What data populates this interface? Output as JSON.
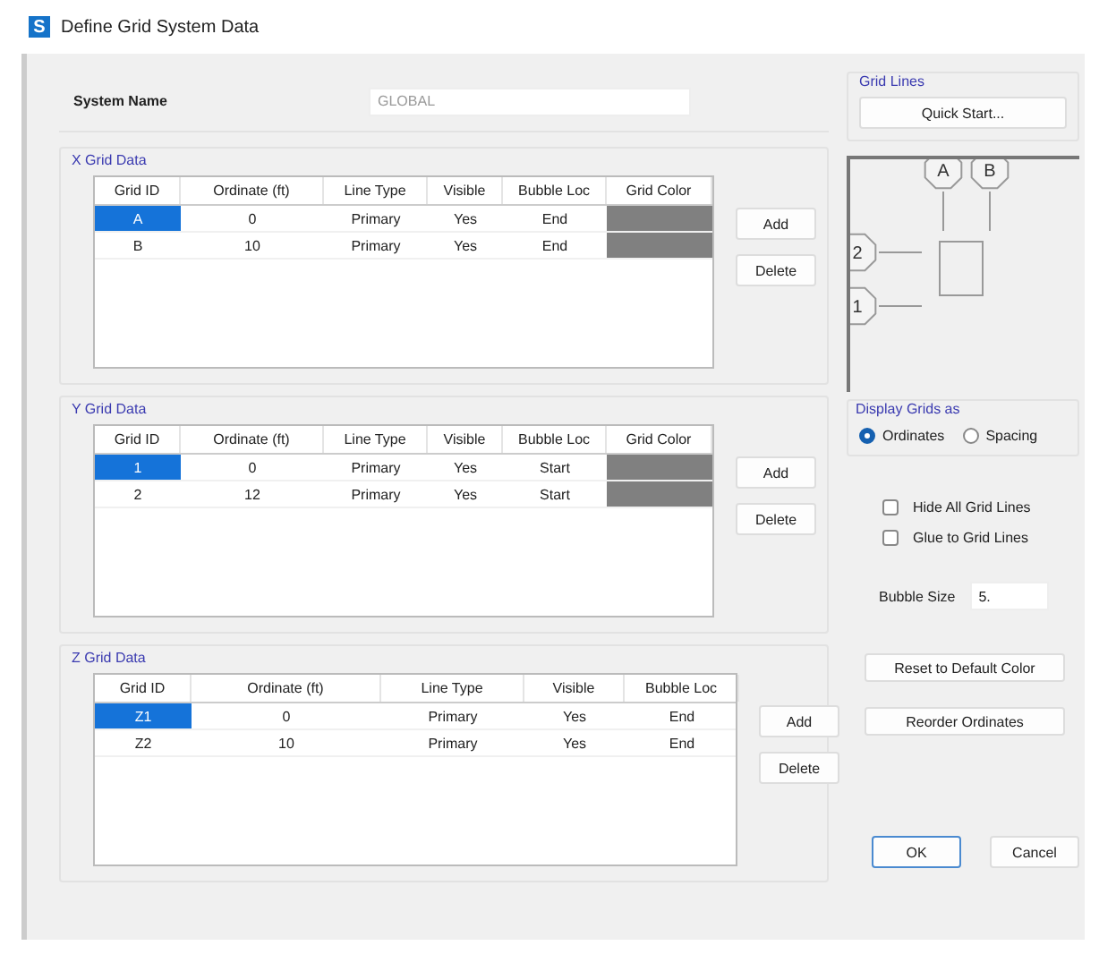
{
  "window": {
    "icon": "S",
    "title": "Define Grid System Data"
  },
  "system_name": {
    "label": "System Name",
    "value": "GLOBAL"
  },
  "grids": [
    {
      "title": "X Grid Data",
      "columns": [
        "Grid ID",
        "Ordinate (ft)",
        "Line Type",
        "Visible",
        "Bubble Loc",
        "Grid Color"
      ],
      "rows": [
        {
          "selected": true,
          "cells": [
            "A",
            "0",
            "Primary",
            "Yes",
            "End"
          ],
          "color": "#808080"
        },
        {
          "selected": false,
          "cells": [
            "B",
            "10",
            "Primary",
            "Yes",
            "End"
          ],
          "color": "#808080"
        }
      ],
      "buttons": [
        "Add",
        "Delete"
      ]
    },
    {
      "title": "Y Grid Data",
      "columns": [
        "Grid ID",
        "Ordinate (ft)",
        "Line Type",
        "Visible",
        "Bubble Loc",
        "Grid Color"
      ],
      "rows": [
        {
          "selected": true,
          "cells": [
            "1",
            "0",
            "Primary",
            "Yes",
            "Start"
          ],
          "color": "#808080"
        },
        {
          "selected": false,
          "cells": [
            "2",
            "12",
            "Primary",
            "Yes",
            "Start"
          ],
          "color": "#808080"
        }
      ],
      "buttons": [
        "Add",
        "Delete"
      ]
    },
    {
      "title": "Z Grid Data",
      "columns": [
        "Grid ID",
        "Ordinate (ft)",
        "Line Type",
        "Visible",
        "Bubble Loc"
      ],
      "rows": [
        {
          "selected": true,
          "cells": [
            "Z1",
            "0",
            "Primary",
            "Yes",
            "End"
          ]
        },
        {
          "selected": false,
          "cells": [
            "Z2",
            "10",
            "Primary",
            "Yes",
            "End"
          ]
        }
      ],
      "buttons": [
        "Add",
        "Delete"
      ]
    }
  ],
  "grid_lines": {
    "title": "Grid Lines",
    "button": "Quick Start..."
  },
  "preview": {
    "x_bubbles": [
      "A",
      "B"
    ],
    "y_bubbles": [
      "2",
      "1"
    ]
  },
  "display_grids": {
    "title": "Display Grids as",
    "options": [
      {
        "label": "Ordinates",
        "selected": true
      },
      {
        "label": "Spacing",
        "selected": false
      }
    ]
  },
  "checkboxes": [
    {
      "label": "Hide All Grid Lines",
      "checked": false
    },
    {
      "label": "Glue to Grid Lines",
      "checked": false
    }
  ],
  "bubble_size": {
    "label": "Bubble Size",
    "value": "5."
  },
  "action_buttons": [
    "Reset to Default Color",
    "Reorder Ordinates"
  ],
  "dialog_buttons": [
    {
      "label": "OK",
      "default": true
    },
    {
      "label": "Cancel",
      "default": false
    }
  ]
}
